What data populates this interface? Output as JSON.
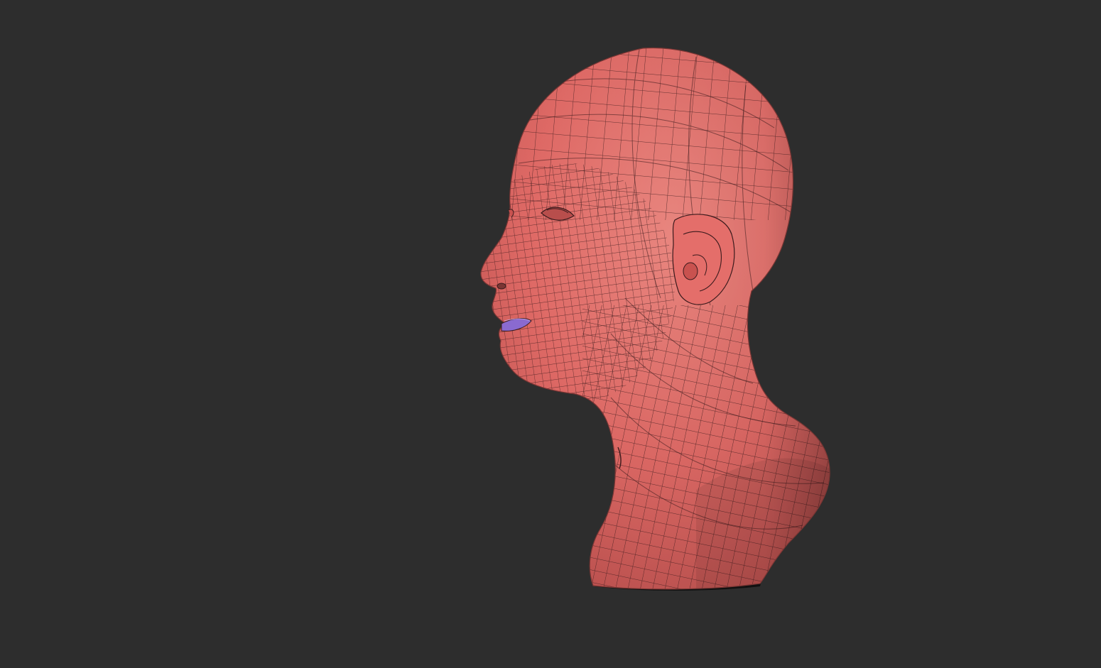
{
  "viewport": {
    "background": "#2d2d2d"
  },
  "model": {
    "subject": "head-bust-mesh",
    "view": "left-profile",
    "display": "polyframe-wireframe",
    "skin_color": "#e06a66",
    "wire_color": "#3a1a1c",
    "mouth_color": "#8a6ad0",
    "shadow_color": "#101010"
  }
}
